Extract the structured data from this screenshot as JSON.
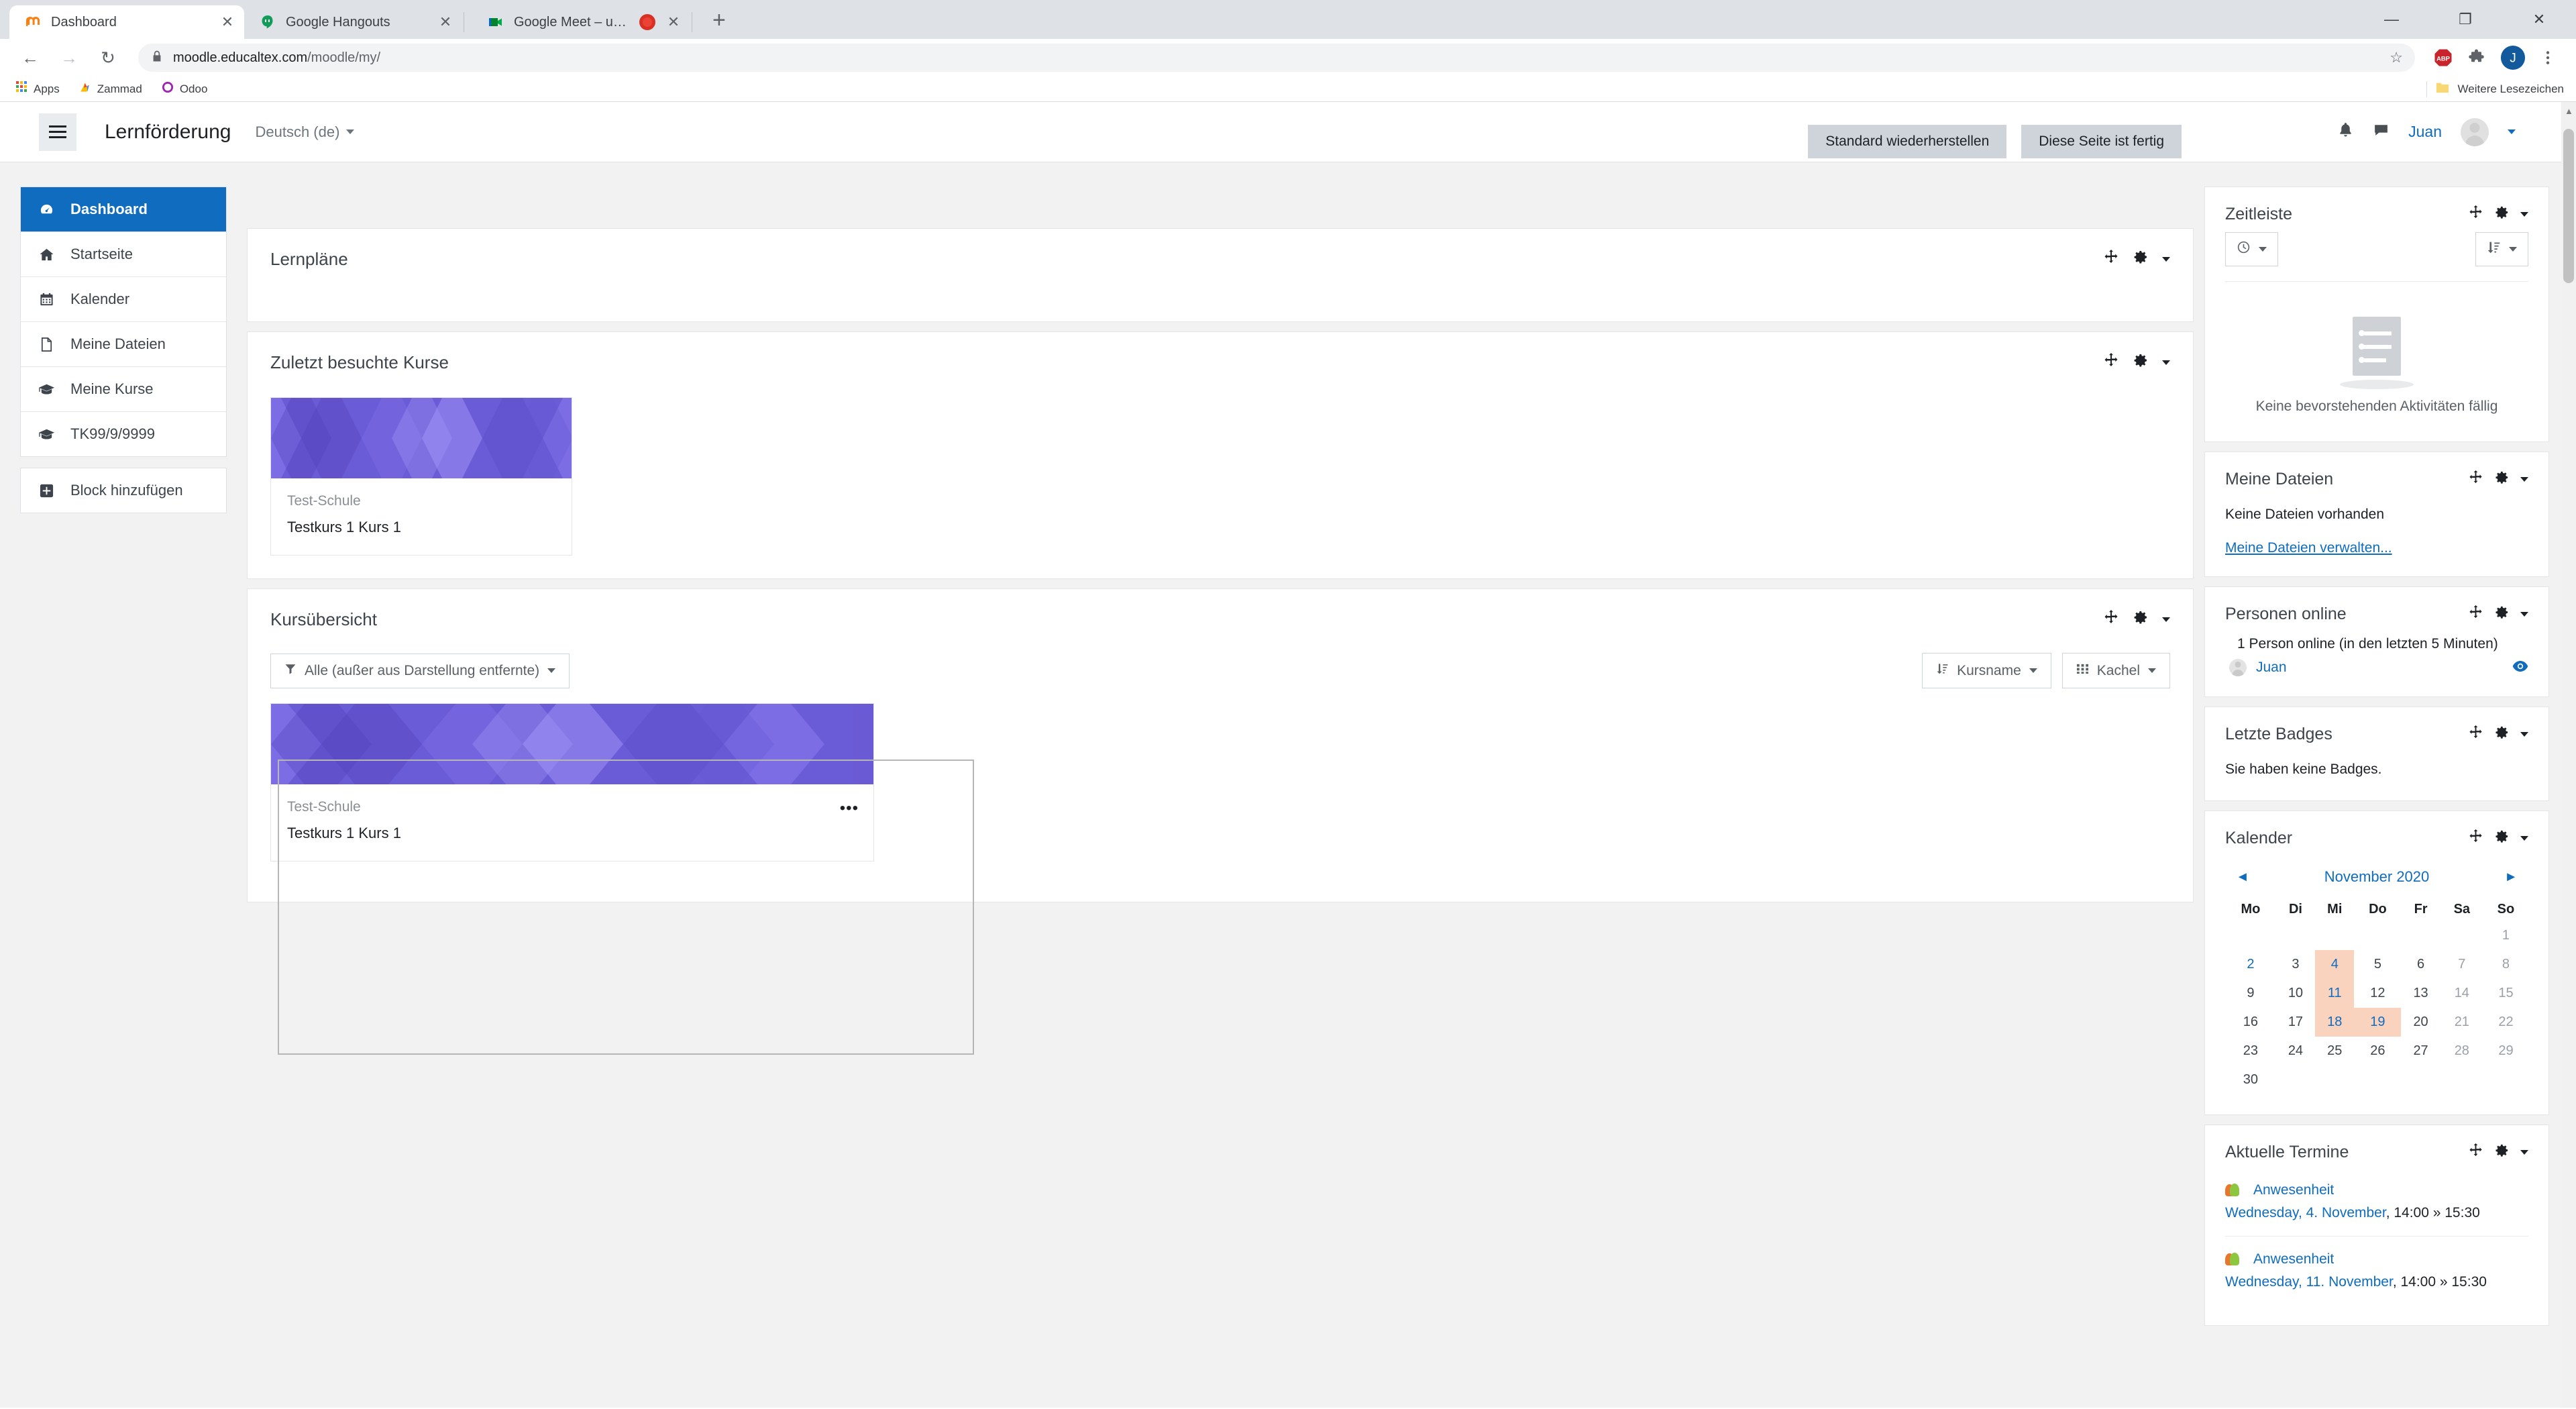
{
  "browser": {
    "tabs": [
      {
        "title": "Dashboard",
        "favicon": "moodle-icon",
        "active": true,
        "recording": false
      },
      {
        "title": "Google Hangouts",
        "favicon": "hangouts-icon",
        "active": false,
        "recording": false
      },
      {
        "title": "Google Meet – ubk-jkxs-rje",
        "favicon": "meet-icon",
        "active": false,
        "recording": true
      }
    ],
    "new_tab_label": "+",
    "window_controls": {
      "minimize": "—",
      "maximize": "❐",
      "close": "✕"
    },
    "nav": {
      "back": "←",
      "forward": "→",
      "reload": "↻"
    },
    "address": {
      "lock": "lock-icon",
      "url_host": "moodle.educaltex.com",
      "url_path": "/moodle/my/",
      "star": "☆"
    },
    "toolbar_icons": [
      "adblock-plus-icon",
      "extensions-puzzle-icon",
      "profile-avatar-icon",
      "kebab-menu-icon"
    ],
    "profile_initial": "J",
    "bookmarks": [
      {
        "label": "Apps",
        "icon": "apps-grid-icon"
      },
      {
        "label": "Zammad",
        "icon": "zammad-icon"
      },
      {
        "label": "Odoo",
        "icon": "odoo-icon"
      }
    ],
    "bookmarks_overflow": {
      "label": "Weitere Lesezeichen",
      "icon": "folder-icon"
    }
  },
  "navbar": {
    "menu_toggle": "hamburger-icon",
    "brand": "Lernförderung",
    "language": "Deutsch (de)",
    "notifications_icon": "bell-icon",
    "messages_icon": "message-bubble-icon",
    "username": "Juan"
  },
  "sidebar": {
    "items": [
      {
        "label": "Dashboard",
        "icon": "dashboard-icon",
        "active": true
      },
      {
        "label": "Startseite",
        "icon": "home-icon",
        "active": false
      },
      {
        "label": "Kalender",
        "icon": "calendar-icon",
        "active": false
      },
      {
        "label": "Meine Dateien",
        "icon": "file-icon",
        "active": false
      },
      {
        "label": "Meine Kurse",
        "icon": "graduation-cap-icon",
        "active": false
      },
      {
        "label": "TK99/9/9999",
        "icon": "graduation-cap-icon",
        "active": false
      }
    ],
    "add_block": {
      "label": "Block hinzufügen",
      "icon": "plus-square-icon"
    }
  },
  "page_buttons": {
    "reset_default": "Standard wiederherstellen",
    "stop_customising": "Diese Seite ist fertig"
  },
  "main": {
    "block_learning_plans": {
      "title": "Lernpläne"
    },
    "block_recent_courses": {
      "title": "Zuletzt besuchte Kurse",
      "courses": [
        {
          "school": "Test-Schule",
          "name": "Testkurs 1 Kurs 1"
        }
      ]
    },
    "block_course_overview": {
      "title": "Kursübersicht",
      "filter": {
        "label": "Alle (außer aus Darstellung entfernte)",
        "icon": "filter-icon"
      },
      "sort": {
        "label": "Kursname",
        "icon": "sort-amount-icon"
      },
      "view": {
        "label": "Kachel",
        "icon": "grid-icon"
      },
      "courses": [
        {
          "school": "Test-Schule",
          "name": "Testkurs 1 Kurs 1",
          "menu": "•••"
        }
      ]
    },
    "block_action_icons": {
      "move": "move-arrows-icon",
      "settings": "gear-icon",
      "caret": "chevron-down-icon"
    }
  },
  "rightbar": {
    "timeline": {
      "title": "Zeitleiste",
      "date_filter": "clock-icon",
      "sort_filter": "sort-amount-icon",
      "empty_message": "Keine bevorstehenden Aktivitäten fällig",
      "empty_image": "checklist-illustration"
    },
    "my_files": {
      "title": "Meine Dateien",
      "empty_message": "Keine Dateien vorhanden",
      "manage_link": "Meine Dateien verwalten..."
    },
    "online_users": {
      "title": "Personen online",
      "count_text": "1 Person online (in den letzten 5 Minuten)",
      "users": [
        {
          "name": "Juan",
          "visibility_icon": "eye-icon"
        }
      ]
    },
    "badges": {
      "title": "Letzte Badges",
      "empty_message": "Sie haben keine Badges."
    },
    "calendar": {
      "title": "Kalender",
      "prev_arrow": "◄",
      "next_arrow": "►",
      "month_label": "November 2020",
      "weekdays": [
        "Mo",
        "Di",
        "Mi",
        "Do",
        "Fr",
        "Sa",
        "So"
      ],
      "weeks": [
        [
          null,
          null,
          null,
          null,
          null,
          null,
          {
            "d": 1,
            "weekend": true
          }
        ],
        [
          {
            "d": 2,
            "today": true
          },
          {
            "d": 3
          },
          {
            "d": 4,
            "event": true,
            "today": true
          },
          {
            "d": 5
          },
          {
            "d": 6
          },
          {
            "d": 7,
            "weekend": true
          },
          {
            "d": 8,
            "weekend": true
          }
        ],
        [
          {
            "d": 9
          },
          {
            "d": 10
          },
          {
            "d": 11,
            "event": true,
            "today": true
          },
          {
            "d": 12
          },
          {
            "d": 13
          },
          {
            "d": 14,
            "weekend": true
          },
          {
            "d": 15,
            "weekend": true
          }
        ],
        [
          {
            "d": 16
          },
          {
            "d": 17
          },
          {
            "d": 18,
            "event": true,
            "today": true
          },
          {
            "d": 19,
            "event": true,
            "today": true
          },
          {
            "d": 20
          },
          {
            "d": 21,
            "weekend": true
          },
          {
            "d": 22,
            "weekend": true
          }
        ],
        [
          {
            "d": 23
          },
          {
            "d": 24
          },
          {
            "d": 25
          },
          {
            "d": 26
          },
          {
            "d": 27
          },
          {
            "d": 28,
            "weekend": true
          },
          {
            "d": 29,
            "weekend": true
          }
        ],
        [
          {
            "d": 30
          },
          null,
          null,
          null,
          null,
          null,
          null
        ]
      ]
    },
    "upcoming_events": {
      "title": "Aktuelle Termine",
      "events": [
        {
          "name": "Anwesenheit",
          "date": "Wednesday, 4. November",
          "time": ", 14:00 » 15:30",
          "icon": "attendance-users-icon"
        },
        {
          "name": "Anwesenheit",
          "date": "Wednesday, 11. November",
          "time": ", 14:00 » 15:30",
          "icon": "attendance-users-icon"
        }
      ]
    }
  },
  "colors": {
    "accent_blue": "#0f6cbf",
    "course_tile_purple": "#6a5bd6",
    "calendar_event_bg": "#fad3bf",
    "block_border": "#e3e6e8"
  }
}
